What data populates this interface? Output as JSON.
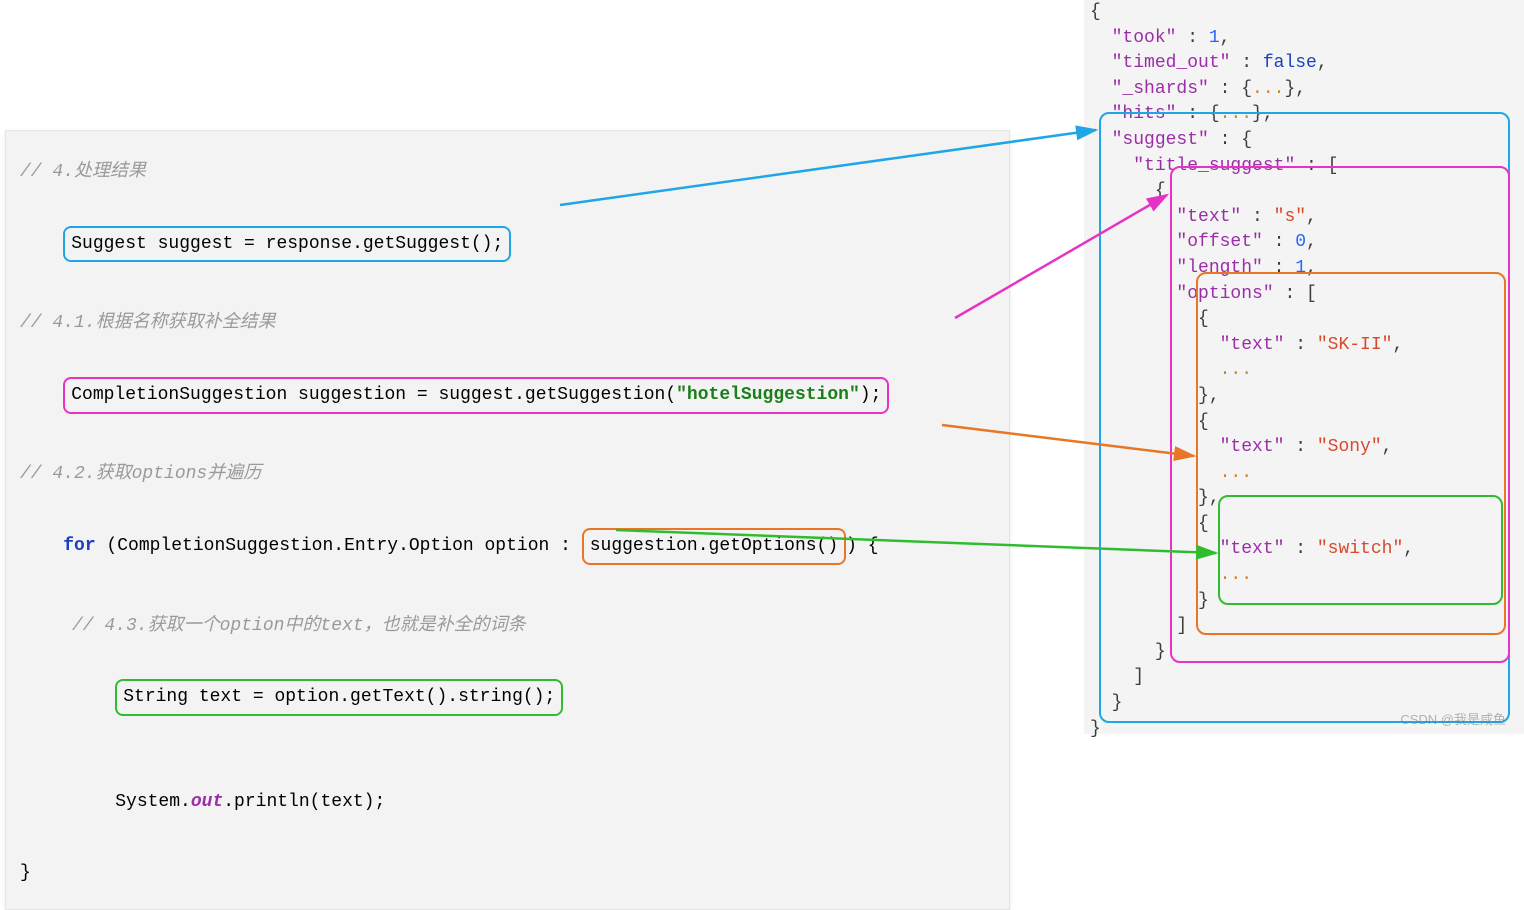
{
  "left": {
    "c1": "// 4.处理结果",
    "line1": "Suggest suggest = response.getSuggest();",
    "c2": "// 4.1.根据名称获取补全结果",
    "line2_pre": "CompletionSuggestion suggestion = suggest.getSuggestion(",
    "line2_arg": "\"hotelSuggestion\"",
    "line2_post": ");",
    "c3": "// 4.2.获取options并遍历",
    "for_kw": "for",
    "for_decl": " (CompletionSuggestion.Entry.Option option : ",
    "for_call": "suggestion.getOptions()",
    "for_end": ") {",
    "c4": "// 4.3.获取一个option中的text，也就是补全的词条",
    "line4": "String text = option.getText().string();",
    "print_pre": "System.",
    "print_out": "out",
    "print_post": ".println(text);",
    "close": "}"
  },
  "json": {
    "took_k": "\"took\"",
    "took_v": "1",
    "timed_k": "\"timed_out\"",
    "timed_v": "false",
    "shards_k": "\"_shards\"",
    "hits_k": "\"hits\"",
    "dots": "...",
    "suggest_k": "\"suggest\"",
    "title_suggest_k": "\"title_suggest\"",
    "text_k": "\"text\"",
    "text_v": "\"s\"",
    "offset_k": "\"offset\"",
    "offset_v": "0",
    "length_k": "\"length\"",
    "length_v": "1",
    "options_k": "\"options\"",
    "opt1_v": "\"SK-II\"",
    "opt2_v": "\"Sony\"",
    "opt3_v": "\"switch\""
  },
  "punct": {
    "colon": " : ",
    "comma": ",",
    "obr": "{",
    "cbr": "}",
    "osq": "[",
    "csq": "]"
  },
  "watermark": "CSDN @我是咸鱼"
}
